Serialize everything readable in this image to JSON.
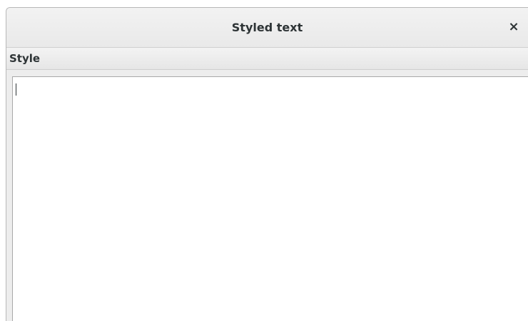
{
  "window": {
    "title": "Styled text",
    "close_glyph": "×"
  },
  "menubar": {
    "items": [
      {
        "label": "Style"
      }
    ]
  },
  "editor": {
    "text": ""
  },
  "icons": {
    "close": "close-icon"
  },
  "colors": {
    "text": "#2e3436",
    "titlebar": "#ededed",
    "editor_bg": "#ffffff"
  }
}
